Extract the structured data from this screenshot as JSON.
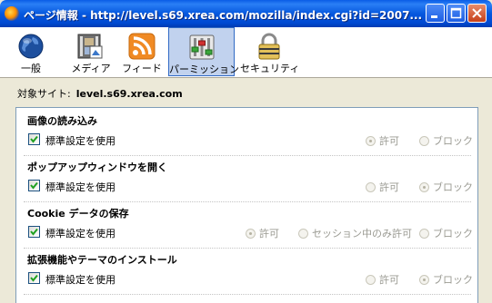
{
  "window": {
    "title": "ページ情報 - http://level.s69.xrea.com/mozilla/index.cgi?id=2007..."
  },
  "toolbar": {
    "tabs": [
      {
        "label": "一般",
        "icon": "globe-icon"
      },
      {
        "label": "メディア",
        "icon": "media-icon"
      },
      {
        "label": "フィード",
        "icon": "feed-icon"
      },
      {
        "label": "パーミッション",
        "icon": "permissions-icon",
        "selected": true
      },
      {
        "label": "セキュリティ",
        "icon": "lock-icon"
      }
    ]
  },
  "site": {
    "label": "対象サイト:",
    "value": "level.s69.xrea.com"
  },
  "permissions": [
    {
      "title": "画像の読み込み",
      "use_default_label": "標準設定を使用",
      "use_default_checked": true,
      "options": [
        {
          "label": "許可",
          "selected": true
        },
        {
          "label": "ブロック",
          "selected": false
        }
      ]
    },
    {
      "title": "ポップアップウィンドウを開く",
      "use_default_label": "標準設定を使用",
      "use_default_checked": true,
      "options": [
        {
          "label": "許可",
          "selected": false
        },
        {
          "label": "ブロック",
          "selected": true
        }
      ]
    },
    {
      "title": "Cookie データの保存",
      "use_default_label": "標準設定を使用",
      "use_default_checked": true,
      "options": [
        {
          "label": "許可",
          "selected": true
        },
        {
          "label": "セッション中のみ許可",
          "selected": false
        },
        {
          "label": "ブロック",
          "selected": false
        }
      ]
    },
    {
      "title": "拡張機能やテーマのインストール",
      "use_default_label": "標準設定を使用",
      "use_default_checked": true,
      "options": [
        {
          "label": "許可",
          "selected": false
        },
        {
          "label": "ブロック",
          "selected": true
        }
      ]
    }
  ],
  "colors": {
    "titlebar": "#0058e6",
    "selected_tab": "#c1d2ee",
    "dialog_bg": "#ece9d8"
  }
}
